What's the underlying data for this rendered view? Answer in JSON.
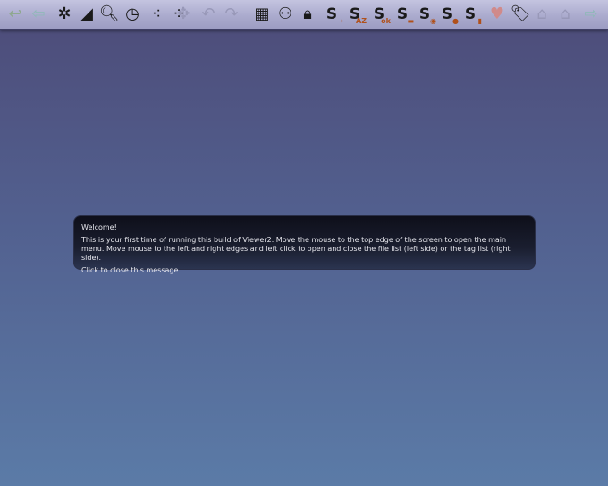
{
  "toolbar": {
    "buttons": [
      {
        "name": "open-folder-back",
        "glyph": "↩",
        "disabled": true
      },
      {
        "name": "back-arrow",
        "glyph": "⇦",
        "disabled": true
      },
      {
        "name": "settings-star",
        "glyph": "✲",
        "disabled": false
      },
      {
        "name": "folder",
        "glyph": "◢",
        "disabled": false
      },
      {
        "name": "search",
        "glyph": "🔍︎",
        "disabled": false
      },
      {
        "name": "clock",
        "glyph": "◷",
        "disabled": false
      },
      {
        "name": "triangles-a",
        "glyph": "⁖",
        "disabled": false
      },
      {
        "name": "triangles-b",
        "glyph": "⁘",
        "disabled": false
      },
      {
        "name": "move",
        "glyph": "✥",
        "disabled": true
      },
      {
        "name": "undo",
        "glyph": "↶",
        "disabled": true
      },
      {
        "name": "redo",
        "glyph": "↷",
        "disabled": true
      },
      {
        "name": "network",
        "glyph": "▦",
        "disabled": false
      },
      {
        "name": "group",
        "glyph": "⚇",
        "disabled": false
      },
      {
        "name": "lock",
        "glyph": "🔒︎",
        "disabled": false
      },
      {
        "name": "sort-arrow",
        "glyph": "S",
        "sub": "→",
        "disabled": false
      },
      {
        "name": "sort-az",
        "glyph": "S",
        "sub": "AZ",
        "disabled": false
      },
      {
        "name": "sort-ok",
        "glyph": "S",
        "sub": "ok",
        "disabled": false
      },
      {
        "name": "sort-rect",
        "glyph": "S",
        "sub": "▬",
        "disabled": false
      },
      {
        "name": "sort-eye",
        "glyph": "S",
        "sub": "◉",
        "disabled": false
      },
      {
        "name": "sort-clock",
        "glyph": "S",
        "sub": "●",
        "disabled": false
      },
      {
        "name": "sort-tag",
        "glyph": "S",
        "sub": "▮",
        "disabled": false
      },
      {
        "name": "favorite-heart",
        "glyph": "♥",
        "disabled": true
      },
      {
        "name": "tag-search",
        "glyph": "🏷︎",
        "disabled": false
      },
      {
        "name": "tag-add",
        "glyph": "⌂",
        "disabled": true
      },
      {
        "name": "tag-question",
        "glyph": "⌂",
        "disabled": true
      },
      {
        "name": "forward-arrow",
        "glyph": "⇨",
        "disabled": true
      }
    ]
  },
  "message": {
    "title": "Welcome!",
    "body": "This is your first time of running this build of Viewer2. Move the mouse to the top edge of the screen to open the main menu. Move mouse to the left and right edges and left click to open and close the file list (left side) or the tag list (right side).",
    "footer": "Click to close this message."
  }
}
